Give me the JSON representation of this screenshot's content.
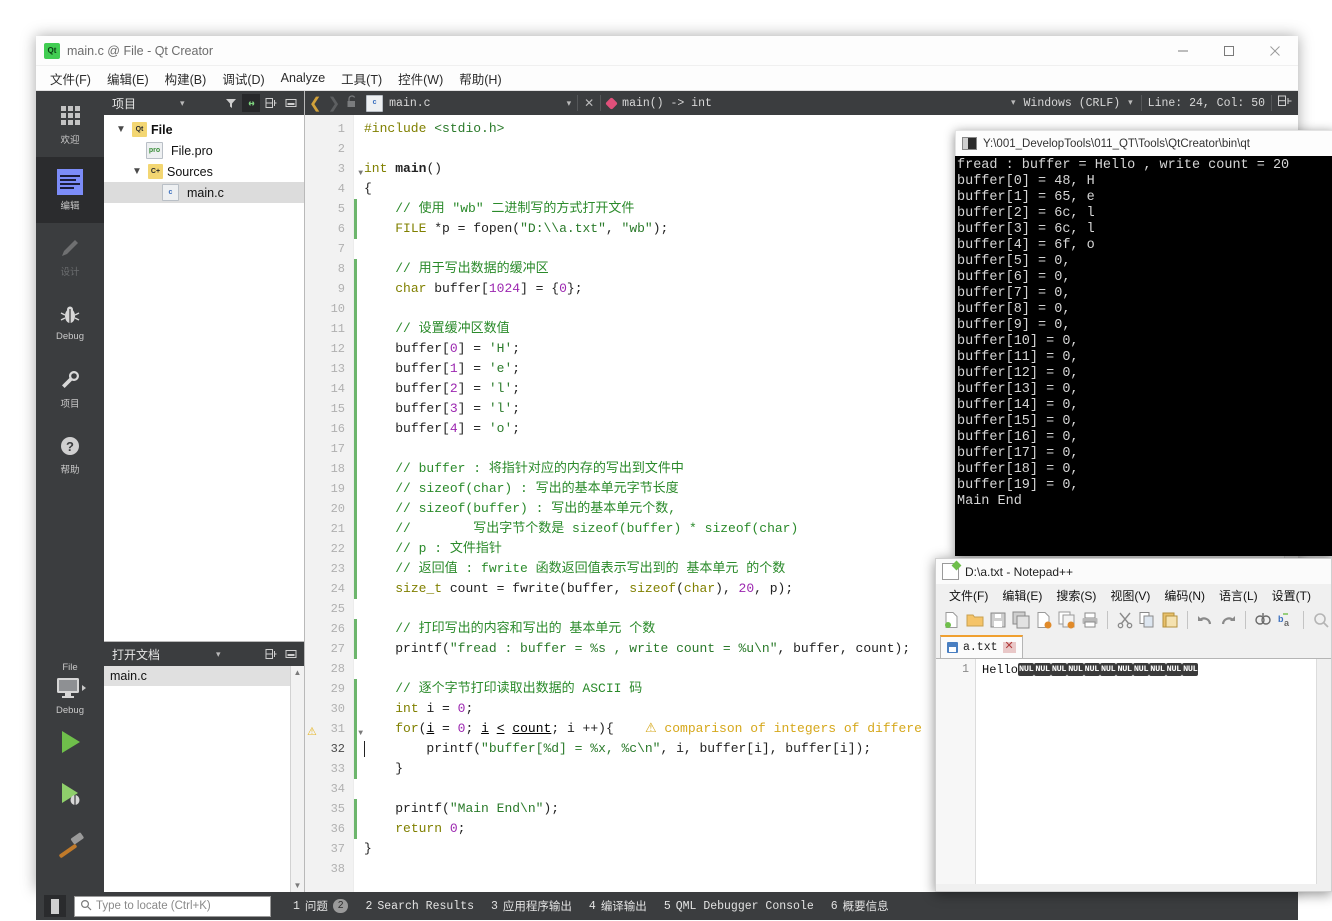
{
  "qt_window": {
    "title": "main.c @ File - Qt Creator",
    "logo_text": "Qt",
    "window_buttons": {
      "minimize": "minimize-icon",
      "maximize": "maximize-icon",
      "close": "close-icon"
    },
    "menu": [
      "文件(F)",
      "编辑(E)",
      "构建(B)",
      "调试(D)",
      "Analyze",
      "工具(T)",
      "控件(W)",
      "帮助(H)"
    ]
  },
  "modebar": {
    "items": [
      {
        "label": "欢迎",
        "icon": "grid-icon",
        "active": false,
        "dim": false
      },
      {
        "label": "编辑",
        "icon": "edit-lines-icon",
        "active": true,
        "dim": false
      },
      {
        "label": "设计",
        "icon": "pencil-icon",
        "active": false,
        "dim": true
      },
      {
        "label": "Debug",
        "icon": "bug-icon",
        "active": false,
        "dim": false
      },
      {
        "label": "项目",
        "icon": "wrench-icon",
        "active": false,
        "dim": false
      },
      {
        "label": "帮助",
        "icon": "question-circle-icon",
        "active": false,
        "dim": false
      }
    ],
    "kit_label": "File",
    "build_config_label": "Debug",
    "run_icon": "run-triangle-icon",
    "debug_icon": "debug-run-icon",
    "build_icon": "hammer-icon"
  },
  "project_pane": {
    "title": "项目",
    "tools": [
      "filter-icon",
      "link-icon",
      "split-icon",
      "close-pane-icon"
    ],
    "tree": [
      {
        "label": "File",
        "icon": "qt-project-icon",
        "indent": 0,
        "chevron": "▼",
        "bold": true,
        "selected": false
      },
      {
        "label": "File.pro",
        "icon": "pro-file-icon",
        "indent": 1,
        "chevron": "",
        "bold": false,
        "selected": false
      },
      {
        "label": "Sources",
        "icon": "sources-folder-icon",
        "indent": 1,
        "chevron": "▼",
        "bold": false,
        "selected": false
      },
      {
        "label": "main.c",
        "icon": "c-file-icon",
        "indent": 2,
        "chevron": "",
        "bold": false,
        "selected": true
      }
    ]
  },
  "open_documents": {
    "title": "打开文档",
    "tools": [
      "split-icon",
      "close-pane-icon"
    ],
    "items": [
      "main.c"
    ]
  },
  "editor_toolbar": {
    "back_icon": "back-arrow-icon",
    "forward_icon": "forward-arrow-icon",
    "lock_icon": "unlock-icon",
    "file_icon": "c-file-icon",
    "file_name": "main.c",
    "close_icon": "close-icon",
    "symbol_label": "main() -> int",
    "line_ending": "Windows (CRLF)",
    "cursor_position": "Line: 24, Col: 50",
    "split_icon": "split-editor-icon"
  },
  "code": {
    "file_name": "main.c",
    "total_lines": 38,
    "warning_line": 31,
    "cursor_line": 32,
    "warning_text": "comparison of integers of differe",
    "lines": [
      {
        "n": 1,
        "block": false,
        "html": "<span class=\"pp\">#include</span> <span class=\"inc\">&lt;stdio.h&gt;</span>"
      },
      {
        "n": 2,
        "block": false,
        "html": ""
      },
      {
        "n": 3,
        "block": false,
        "fold": true,
        "html": "<span class=\"kw\">int</span> <span class=\"fn\"><b>main</b></span><span class=\"plain\">()</span>"
      },
      {
        "n": 4,
        "block": false,
        "html": "<span class=\"plain\">{</span>"
      },
      {
        "n": 5,
        "block": true,
        "html": "    <span class=\"cmt\">// 使用 \"wb\" 二进制写的方式打开文件</span>"
      },
      {
        "n": 6,
        "block": true,
        "html": "    <span class=\"type\">FILE</span> <span class=\"plain\">*p = </span><span class=\"fn\">fopen</span><span class=\"plain\">(</span><span class=\"str\">\"D:\\\\a.txt\"</span><span class=\"plain\">, </span><span class=\"str\">\"wb\"</span><span class=\"plain\">);</span>"
      },
      {
        "n": 7,
        "block": false,
        "html": ""
      },
      {
        "n": 8,
        "block": true,
        "html": "    <span class=\"cmt\">// 用于写出数据的缓冲区</span>"
      },
      {
        "n": 9,
        "block": true,
        "html": "    <span class=\"kw\">char</span> <span class=\"plain\">buffer[</span><span class=\"num\">1024</span><span class=\"plain\">] = {</span><span class=\"num\">0</span><span class=\"plain\">};</span>"
      },
      {
        "n": 10,
        "block": true,
        "html": ""
      },
      {
        "n": 11,
        "block": true,
        "html": "    <span class=\"cmt\">// 设置缓冲区数值</span>"
      },
      {
        "n": 12,
        "block": true,
        "html": "    <span class=\"plain\">buffer[</span><span class=\"num\">0</span><span class=\"plain\">] = </span><span class=\"str\">'H'</span><span class=\"plain\">;</span>"
      },
      {
        "n": 13,
        "block": true,
        "html": "    <span class=\"plain\">buffer[</span><span class=\"num\">1</span><span class=\"plain\">] = </span><span class=\"str\">'e'</span><span class=\"plain\">;</span>"
      },
      {
        "n": 14,
        "block": true,
        "html": "    <span class=\"plain\">buffer[</span><span class=\"num\">2</span><span class=\"plain\">] = </span><span class=\"str\">'l'</span><span class=\"plain\">;</span>"
      },
      {
        "n": 15,
        "block": true,
        "html": "    <span class=\"plain\">buffer[</span><span class=\"num\">3</span><span class=\"plain\">] = </span><span class=\"str\">'l'</span><span class=\"plain\">;</span>"
      },
      {
        "n": 16,
        "block": true,
        "html": "    <span class=\"plain\">buffer[</span><span class=\"num\">4</span><span class=\"plain\">] = </span><span class=\"str\">'o'</span><span class=\"plain\">;</span>"
      },
      {
        "n": 17,
        "block": true,
        "html": ""
      },
      {
        "n": 18,
        "block": true,
        "html": "    <span class=\"cmt\">// buffer : 将指针对应的内存的写出到文件中</span>"
      },
      {
        "n": 19,
        "block": true,
        "html": "    <span class=\"cmt\">// sizeof(char) : 写出的基本单元字节长度</span>"
      },
      {
        "n": 20,
        "block": true,
        "html": "    <span class=\"cmt\">// sizeof(buffer) : 写出的基本单元个数,</span>"
      },
      {
        "n": 21,
        "block": true,
        "html": "    <span class=\"cmt\">//        写出字节个数是 sizeof(buffer) * sizeof(char)</span>"
      },
      {
        "n": 22,
        "block": true,
        "html": "    <span class=\"cmt\">// p : 文件指针</span>"
      },
      {
        "n": 23,
        "block": true,
        "html": "    <span class=\"cmt\">// 返回值 : fwrite 函数返回值表示写出到的 基本单元 的个数</span>"
      },
      {
        "n": 24,
        "block": true,
        "html": "    <span class=\"type\">size_t</span> <span class=\"plain\">count = </span><span class=\"fn\">fwrite</span><span class=\"plain\">(buffer, </span><span class=\"kw\">sizeof</span><span class=\"plain\">(</span><span class=\"kw\">char</span><span class=\"plain\">), </span><span class=\"num\">20</span><span class=\"plain\">, p);</span>"
      },
      {
        "n": 25,
        "block": false,
        "html": ""
      },
      {
        "n": 26,
        "block": true,
        "html": "    <span class=\"cmt\">// 打印写出的内容和写出的 基本单元 个数</span>"
      },
      {
        "n": 27,
        "block": true,
        "html": "    <span class=\"fn\">printf</span><span class=\"plain\">(</span><span class=\"str\">\"fread : buffer = %s , write count = %u\\n\"</span><span class=\"plain\">, buffer, count);</span>"
      },
      {
        "n": 28,
        "block": false,
        "html": ""
      },
      {
        "n": 29,
        "block": true,
        "html": "    <span class=\"cmt\">// 逐个字节打印读取出数据的 ASCII 码</span>"
      },
      {
        "n": 30,
        "block": true,
        "html": "    <span class=\"kw\">int</span> <span class=\"plain\">i = </span><span class=\"num\">0</span><span class=\"plain\">;</span>"
      },
      {
        "n": 31,
        "block": true,
        "fold": true,
        "warn": true,
        "html": "    <span class=\"kw\">for</span><span class=\"plain\">(</span><span class=\"underline\">i</span><span class=\"plain\"> = </span><span class=\"num\">0</span><span class=\"plain\">; </span><span class=\"underline\">i</span><span class=\"plain\"> </span><span class=\"underline\">&lt;</span><span class=\"plain\"> </span><span class=\"underline\">count</span><span class=\"plain\">; i ++){</span>"
      },
      {
        "n": 32,
        "block": true,
        "cursor": true,
        "html": "        <span class=\"fn\">printf</span><span class=\"plain\">(</span><span class=\"str\">\"buffer[%d] = %x, %c\\n\"</span><span class=\"plain\">, i, buffer[i], buffer[i]);</span>"
      },
      {
        "n": 33,
        "block": true,
        "html": "    <span class=\"plain\">}</span>"
      },
      {
        "n": 34,
        "block": false,
        "html": ""
      },
      {
        "n": 35,
        "block": true,
        "html": "    <span class=\"fn\">printf</span><span class=\"plain\">(</span><span class=\"str\">\"Main End\\n\"</span><span class=\"plain\">);</span>"
      },
      {
        "n": 36,
        "block": true,
        "html": "    <span class=\"kw\">return</span> <span class=\"num\">0</span><span class=\"plain\">;</span>"
      },
      {
        "n": 37,
        "block": false,
        "html": "<span class=\"plain\">}</span>"
      },
      {
        "n": 38,
        "block": false,
        "html": ""
      }
    ]
  },
  "status_bar": {
    "toggle_sidebar_icon": "toggle-sidebar-icon",
    "locator_placeholder": "Type to locate (Ctrl+K)",
    "search_icon": "search-icon",
    "tabs": [
      {
        "num": "1",
        "label": "问题",
        "badge": "2"
      },
      {
        "num": "2",
        "label": "Search Results",
        "badge": ""
      },
      {
        "num": "3",
        "label": "应用程序输出",
        "badge": ""
      },
      {
        "num": "4",
        "label": "编译输出",
        "badge": ""
      },
      {
        "num": "5",
        "label": "QML Debugger Console",
        "badge": ""
      },
      {
        "num": "6",
        "label": "概要信息",
        "badge": ""
      }
    ]
  },
  "console_window": {
    "icon": "console-icon",
    "title": "Y:\\001_DevelopTools\\011_QT\\Tools\\QtCreator\\bin\\qt",
    "output": "fread : buffer = Hello , write count = 20\nbuffer[0] = 48, H\nbuffer[1] = 65, e\nbuffer[2] = 6c, l\nbuffer[3] = 6c, l\nbuffer[4] = 6f, o\nbuffer[5] = 0,\nbuffer[6] = 0,\nbuffer[7] = 0,\nbuffer[8] = 0,\nbuffer[9] = 0,\nbuffer[10] = 0,\nbuffer[11] = 0,\nbuffer[12] = 0,\nbuffer[13] = 0,\nbuffer[14] = 0,\nbuffer[15] = 0,\nbuffer[16] = 0,\nbuffer[17] = 0,\nbuffer[18] = 0,\nbuffer[19] = 0,\nMain End"
  },
  "notepad": {
    "title": "D:\\a.txt - Notepad++",
    "icon": "notepad-plus-plus-icon",
    "menu": [
      "文件(F)",
      "编辑(E)",
      "搜索(S)",
      "视图(V)",
      "编码(N)",
      "语言(L)",
      "设置(T)"
    ],
    "toolbar_icons": [
      "new-file-icon",
      "open-file-icon",
      "save-icon",
      "save-all-icon",
      "close-file-icon",
      "close-all-icon",
      "print-icon",
      "sep",
      "cut-icon",
      "copy-icon",
      "paste-icon",
      "sep",
      "undo-icon",
      "redo-icon",
      "sep",
      "find-icon",
      "replace-icon",
      "sep",
      "zoom-in-icon"
    ],
    "tab": {
      "label": "a.txt",
      "save_icon": "save-icon",
      "close_icon": "close-tab-icon"
    },
    "line_number": "1",
    "content_text": "Hello",
    "nul_count": 11,
    "nul_label": "NUL"
  }
}
